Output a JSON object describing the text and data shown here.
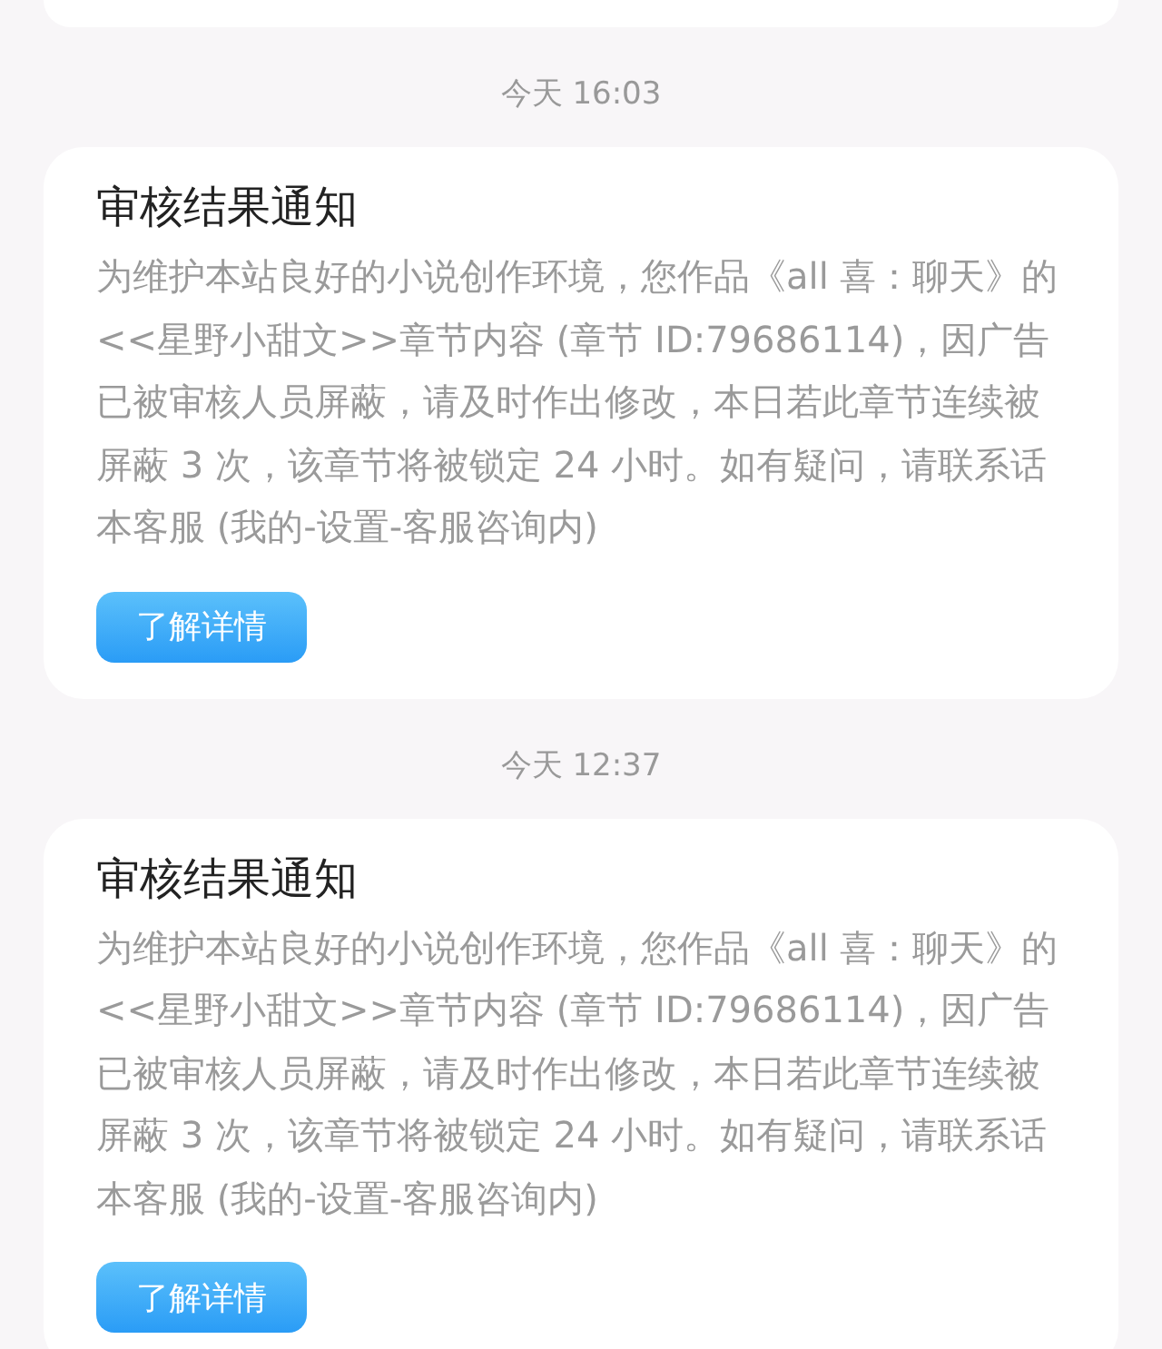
{
  "notifications": [
    {
      "time": "今天 16:03",
      "title": "审核结果通知",
      "body": "为维护本站良好的小说创作环境，您作品《all 喜：聊天》的<<星野小甜文>>章节内容 (章节 ID:79686114)，因广告已被审核人员屏蔽，请及时作出修改，本日若此章节连续被屏蔽 3 次，该章节将被锁定 24 小时。如有疑问，请联系话本客服 (我的-设置-客服咨询内)",
      "button": "了解详情"
    },
    {
      "time": "今天 12:37",
      "title": "审核结果通知",
      "body": "为维护本站良好的小说创作环境，您作品《all 喜：聊天》的<<星野小甜文>>章节内容 (章节 ID:79686114)，因广告已被审核人员屏蔽，请及时作出修改，本日若此章节连续被屏蔽 3 次，该章节将被锁定 24 小时。如有疑问，请联系话本客服 (我的-设置-客服咨询内)",
      "button": "了解详情"
    }
  ]
}
